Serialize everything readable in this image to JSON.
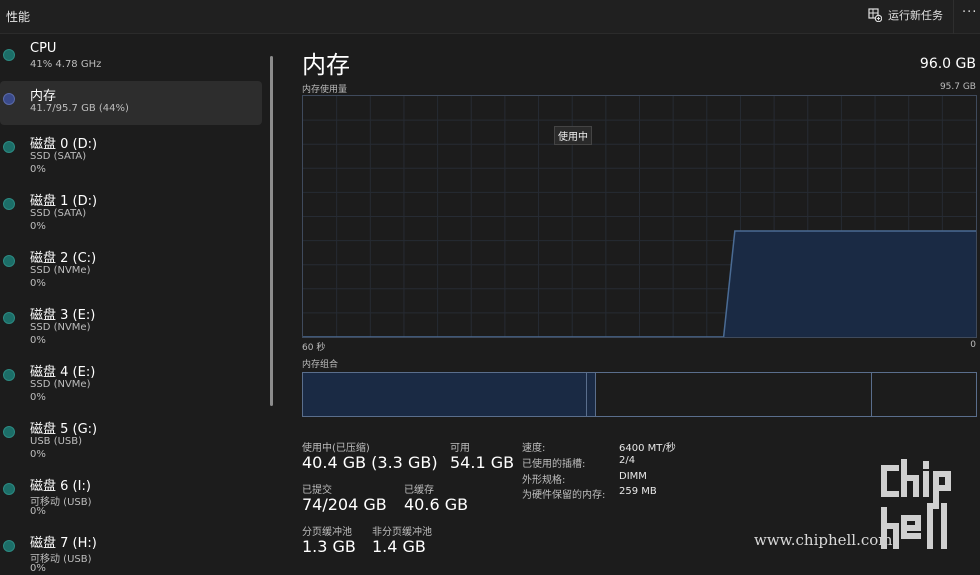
{
  "topbar": {
    "title": "性能",
    "run_task_label": "运行新任务",
    "more_label": "···"
  },
  "sidebar": {
    "items": [
      {
        "name": "CPU",
        "sub1": "41% 4.78 GHz",
        "sub2": "",
        "color": "#1c6e68"
      },
      {
        "name": "内存",
        "sub1": "41.7/95.7 GB (44%)",
        "sub2": "",
        "color": "#3a4a8a"
      },
      {
        "name": "磁盘 0 (D:)",
        "sub1": "SSD (SATA)",
        "sub2": "0%",
        "color": "#1c6e68"
      },
      {
        "name": "磁盘 1 (D:)",
        "sub1": "SSD (SATA)",
        "sub2": "0%",
        "color": "#1c6e68"
      },
      {
        "name": "磁盘 2 (C:)",
        "sub1": "SSD (NVMe)",
        "sub2": "0%",
        "color": "#1c6e68"
      },
      {
        "name": "磁盘 3 (E:)",
        "sub1": "SSD (NVMe)",
        "sub2": "0%",
        "color": "#1c6e68"
      },
      {
        "name": "磁盘 4 (E:)",
        "sub1": "SSD (NVMe)",
        "sub2": "0%",
        "color": "#1c6e68"
      },
      {
        "name": "磁盘 5 (G:)",
        "sub1": "USB (USB)",
        "sub2": "0%",
        "color": "#1c6e68"
      },
      {
        "name": "磁盘 6 (I:)",
        "sub1": "可移动 (USB)",
        "sub2": "0%",
        "color": "#1c6e68"
      },
      {
        "name": "磁盘 7 (H:)",
        "sub1": "可移动 (USB)",
        "sub2": "0%",
        "color": "#1c6e68"
      }
    ]
  },
  "main": {
    "title": "内存",
    "capacity": "96.0 GB",
    "usage_label": "内存使用量",
    "usage_max": "95.7 GB",
    "time_left": "60 秒",
    "time_right": "0",
    "tooltip": "使用中",
    "composition_label": "内存组合"
  },
  "stats": {
    "in_use_label": "使用中(已压缩)",
    "in_use_value": "40.4 GB (3.3 GB)",
    "available_label": "可用",
    "available_value": "54.1 GB",
    "committed_label": "已提交",
    "committed_value": "74/204 GB",
    "cached_label": "已缓存",
    "cached_value": "40.6 GB",
    "paged_label": "分页缓冲池",
    "paged_value": "1.3 GB",
    "nonpaged_label": "非分页缓冲池",
    "nonpaged_value": "1.4 GB"
  },
  "specs": {
    "speed_label": "速度:",
    "speed_value": "6400 MT/秒",
    "slots_label": "已使用的插槽:",
    "slots_value": "2/4",
    "form_label": "外形规格:",
    "form_value": "DIMM",
    "reserved_label": "为硬件保留的内存:",
    "reserved_value": "259 MB"
  },
  "chart_data": {
    "type": "area",
    "title": "内存使用量",
    "xlabel": "",
    "ylabel": "",
    "x_range_label": [
      "60 秒",
      "0"
    ],
    "ylim": [
      0,
      95.7
    ],
    "usage_percent_points": [
      {
        "seconds_ago": 60,
        "percent": 0
      },
      {
        "seconds_ago": 22.5,
        "percent": 0
      },
      {
        "seconds_ago": 21.5,
        "percent": 44
      },
      {
        "seconds_ago": 0,
        "percent": 44
      }
    ],
    "accent_color": "#4a6b94",
    "fill_color": "#1a2a44"
  },
  "composition": {
    "segments": [
      {
        "name": "in-use",
        "fraction": 0.422,
        "fill": "#1a2a44"
      },
      {
        "name": "modified",
        "fraction": 0.013,
        "fill": "#1a2a44"
      },
      {
        "name": "standby",
        "fraction": 0.41,
        "fill": "#1c1c1c"
      },
      {
        "name": "free",
        "fraction": 0.155,
        "fill": "#1c1c1c"
      }
    ]
  },
  "watermark": {
    "url": "www.chiphell.com",
    "logo_text": "chiphell"
  }
}
